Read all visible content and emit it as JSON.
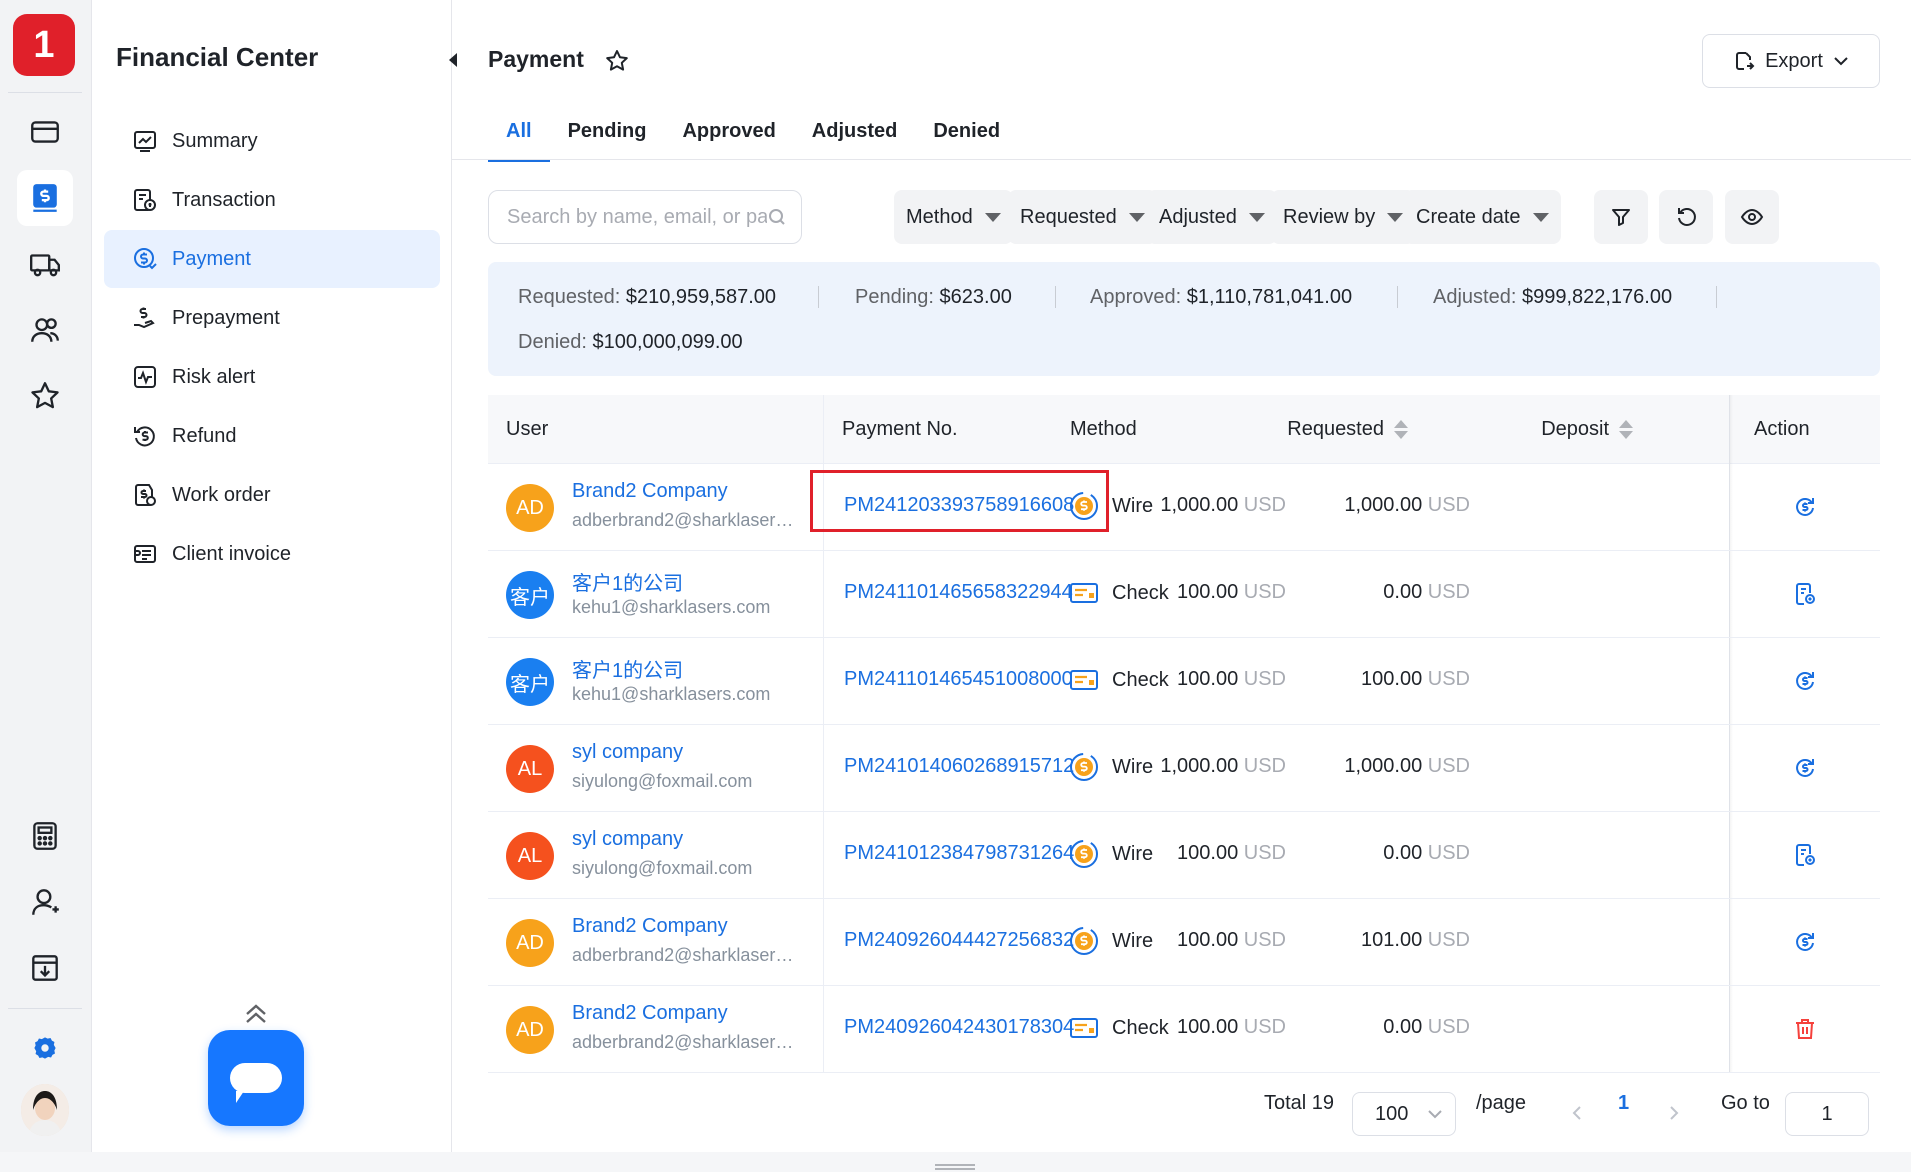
{
  "app": {
    "logo": "1"
  },
  "rail": {
    "icons": [
      "card-icon",
      "payment-doc-icon",
      "truck-icon",
      "users-icon",
      "star-icon",
      "calculator-icon",
      "user-icon",
      "download-doc-icon",
      "settings-icon"
    ]
  },
  "sidebar": {
    "title": "Financial Center",
    "items": [
      {
        "label": "Summary",
        "icon": "chart-icon"
      },
      {
        "label": "Transaction",
        "icon": "transaction-icon"
      },
      {
        "label": "Payment",
        "icon": "payment-icon",
        "active": true
      },
      {
        "label": "Prepayment",
        "icon": "prepayment-icon"
      },
      {
        "label": "Risk alert",
        "icon": "risk-alert-icon"
      },
      {
        "label": "Refund",
        "icon": "refund-icon"
      },
      {
        "label": "Work order",
        "icon": "work-order-icon"
      },
      {
        "label": "Client invoice",
        "icon": "client-invoice-icon"
      }
    ]
  },
  "header": {
    "title": "Payment",
    "export_label": "Export"
  },
  "tabs": [
    {
      "label": "All",
      "active": true
    },
    {
      "label": "Pending"
    },
    {
      "label": "Approved"
    },
    {
      "label": "Adjusted"
    },
    {
      "label": "Denied"
    }
  ],
  "filters": {
    "search_placeholder": "Search by name, email, or payment No.",
    "dropdowns": [
      "Method",
      "Requested",
      "Adjusted",
      "Review by",
      "Create date"
    ]
  },
  "summary": {
    "requested_label": "Requested:",
    "requested_value": "$210,959,587.00",
    "pending_label": "Pending:",
    "pending_value": "$623.00",
    "approved_label": "Approved:",
    "approved_value": "$1,110,781,041.00",
    "adjusted_label": "Adjusted:",
    "adjusted_value": "$999,822,176.00",
    "denied_label": "Denied:",
    "denied_value": "$100,000,099.00"
  },
  "table": {
    "columns": [
      "User",
      "Payment No.",
      "Method",
      "Requested",
      "Deposit",
      "Action"
    ],
    "currency": "USD",
    "rows": [
      {
        "avatar": "AD",
        "avatar_color": "#f7a21b",
        "name": "Brand2 Company",
        "email": "adberbrand2@sharklasers....",
        "payment_no": "PM241203393758916608",
        "method": "Wire",
        "requested": "1,000.00",
        "deposit": "1,000.00",
        "action": "review-icon"
      },
      {
        "avatar": "客户",
        "avatar_color": "#1a7ff0",
        "name": "客户1的公司",
        "email": "kehu1@sharklasers.com",
        "payment_no": "PM241101465658322944",
        "method": "Check",
        "requested": "100.00",
        "deposit": "0.00",
        "action": "invoice-icon"
      },
      {
        "avatar": "客户",
        "avatar_color": "#1a7ff0",
        "name": "客户1的公司",
        "email": "kehu1@sharklasers.com",
        "payment_no": "PM241101465451008000",
        "method": "Check",
        "requested": "100.00",
        "deposit": "100.00",
        "action": "review-icon"
      },
      {
        "avatar": "AL",
        "avatar_color": "#f5511e",
        "name": "syl company",
        "email": "siyulong@foxmail.com",
        "payment_no": "PM241014060268915712",
        "method": "Wire",
        "requested": "1,000.00",
        "deposit": "1,000.00",
        "action": "review-icon"
      },
      {
        "avatar": "AL",
        "avatar_color": "#f5511e",
        "name": "syl company",
        "email": "siyulong@foxmail.com",
        "payment_no": "PM241012384798731264",
        "method": "Wire",
        "requested": "100.00",
        "deposit": "0.00",
        "action": "invoice-icon"
      },
      {
        "avatar": "AD",
        "avatar_color": "#f7a21b",
        "name": "Brand2 Company",
        "email": "adberbrand2@sharklasers....",
        "payment_no": "PM240926044427256832",
        "method": "Wire",
        "requested": "100.00",
        "deposit": "101.00",
        "action": "review-icon"
      },
      {
        "avatar": "AD",
        "avatar_color": "#f7a21b",
        "name": "Brand2 Company",
        "email": "adberbrand2@sharklasers....",
        "payment_no": "PM240926042430178304",
        "method": "Check",
        "requested": "100.00",
        "deposit": "0.00",
        "action": "delete-icon"
      }
    ]
  },
  "pagination": {
    "total_label": "Total 19",
    "page_size": "100",
    "per_page_label": "/page",
    "current_page": "1",
    "goto_label": "Go to",
    "goto_value": "1"
  },
  "colors": {
    "accent": "#1a6fe0",
    "brand_red": "#e0202a",
    "highlight": "#e0202a"
  }
}
